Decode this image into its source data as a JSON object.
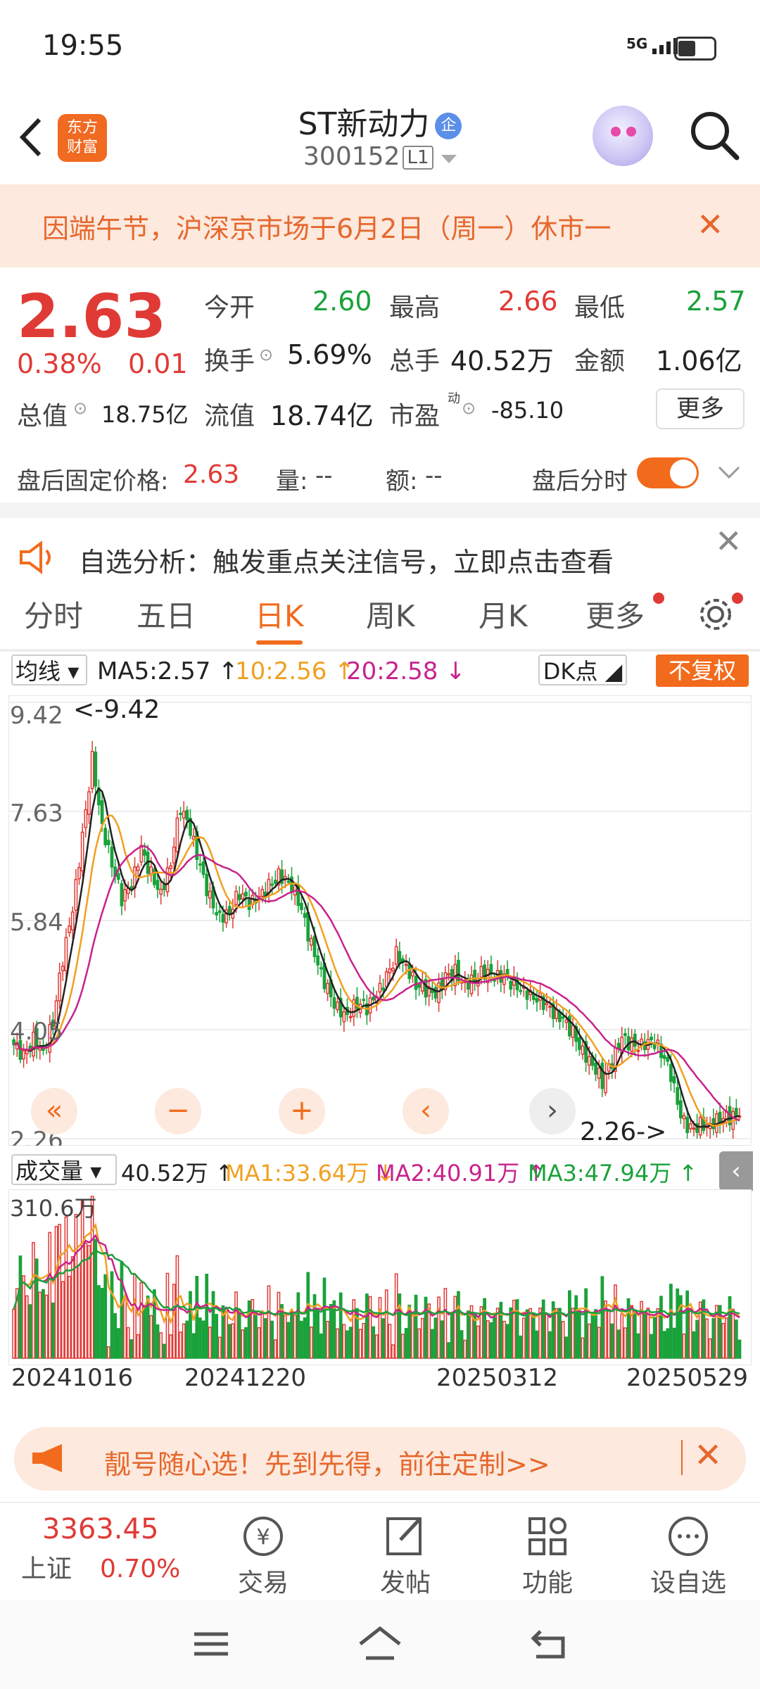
{
  "status_bar": {
    "time": "19:55",
    "network": "5G"
  },
  "header": {
    "logo_text": "东方\n财富",
    "title": "ST新动力",
    "title_badge": "企",
    "code": "300152",
    "level": "L1"
  },
  "notice": {
    "text": "因端午节，沪深京市场于6月2日（周一）休市一",
    "close": "✕"
  },
  "quote": {
    "price": "2.63",
    "change_pct": "0.38%",
    "change_abs": "0.01",
    "open_label": "今开",
    "open": "2.60",
    "high_label": "最高",
    "high": "2.66",
    "low_label": "最低",
    "low": "2.57",
    "turnover_label": "换手",
    "turnover": "5.69%",
    "volume_label": "总手",
    "volume": "40.52万",
    "amount_label": "金额",
    "amount": "1.06亿",
    "mktcap_label": "总值",
    "mktcap": "18.75亿",
    "float_label": "流值",
    "float_cap": "18.74亿",
    "pe_label": "市盈",
    "pe_sup": "动",
    "pe": "-85.10",
    "more_label": "更多"
  },
  "after_hours": {
    "price_label": "盘后固定价格:",
    "price": "2.63",
    "vol_label": "量:",
    "vol": "--",
    "amt_label": "额:",
    "amt": "--",
    "toggle_label": "盘后分时"
  },
  "alert": {
    "text": "自选分析：触发重点关注信号，立即点击查看"
  },
  "tabs": [
    "分时",
    "五日",
    "日K",
    "周K",
    "月K",
    "更多"
  ],
  "active_tab": "日K",
  "ma_row": {
    "selector": "均线",
    "ma5": "MA5:2.57 ↑",
    "ma10": "10:2.56 ↑",
    "ma20": "20:2.58 ↓",
    "dk": "DK点",
    "adjust": "不复权"
  },
  "colors": {
    "up": "#e03a36",
    "down": "#1aa23b",
    "ma5": "#222222",
    "ma10": "#f0a020",
    "ma20": "#c8228c",
    "accent": "#f26b1d"
  },
  "chart_data": {
    "type": "candlestick",
    "y_ticks": [
      "9.42",
      "7.63",
      "5.84",
      "4.05",
      "2.26"
    ],
    "ylim": [
      2.26,
      9.42
    ],
    "max_annotation": "<-9.42",
    "min_annotation": "2.26->",
    "x_ticks": [
      "20241016",
      "20241220",
      "20250312",
      "20250529"
    ],
    "close_trend": [
      3.8,
      3.6,
      3.9,
      3.7,
      4.2,
      5.2,
      6.0,
      7.2,
      8.5,
      7.4,
      6.8,
      6.2,
      6.4,
      7.0,
      6.6,
      6.3,
      6.8,
      7.7,
      7.3,
      6.7,
      6.2,
      5.9,
      6.0,
      6.3,
      6.1,
      6.2,
      6.4,
      6.6,
      6.5,
      6.2,
      5.6,
      5.1,
      4.7,
      4.4,
      4.3,
      4.5,
      4.4,
      4.6,
      4.9,
      5.3,
      5.1,
      4.8,
      4.7,
      4.6,
      4.9,
      5.0,
      4.8,
      4.9,
      5.0,
      4.9,
      4.9,
      4.8,
      4.7,
      4.6,
      4.5,
      4.3,
      4.2,
      4.0,
      3.7,
      3.5,
      3.2,
      3.5,
      3.9,
      3.8,
      3.8,
      3.9,
      3.7,
      3.3,
      2.6,
      2.4,
      2.5,
      2.5,
      2.6,
      2.6,
      2.63
    ],
    "volume": {
      "ylabel": "310.6万",
      "label": "成交量",
      "value": "40.52万 ↑",
      "ma1": "MA1:33.64万 ↓",
      "ma2": "MA2:40.91万 ↑",
      "ma3": "MA3:47.94万 ↑"
    }
  },
  "ad": {
    "text": "靓号随心选！先到先得，前往定制>>"
  },
  "bottom_nav": {
    "index_value": "3363.45",
    "index_name": "上证",
    "index_change": "0.70%",
    "trade": "交易",
    "post": "发帖",
    "function": "功能",
    "watch": "设自选"
  }
}
